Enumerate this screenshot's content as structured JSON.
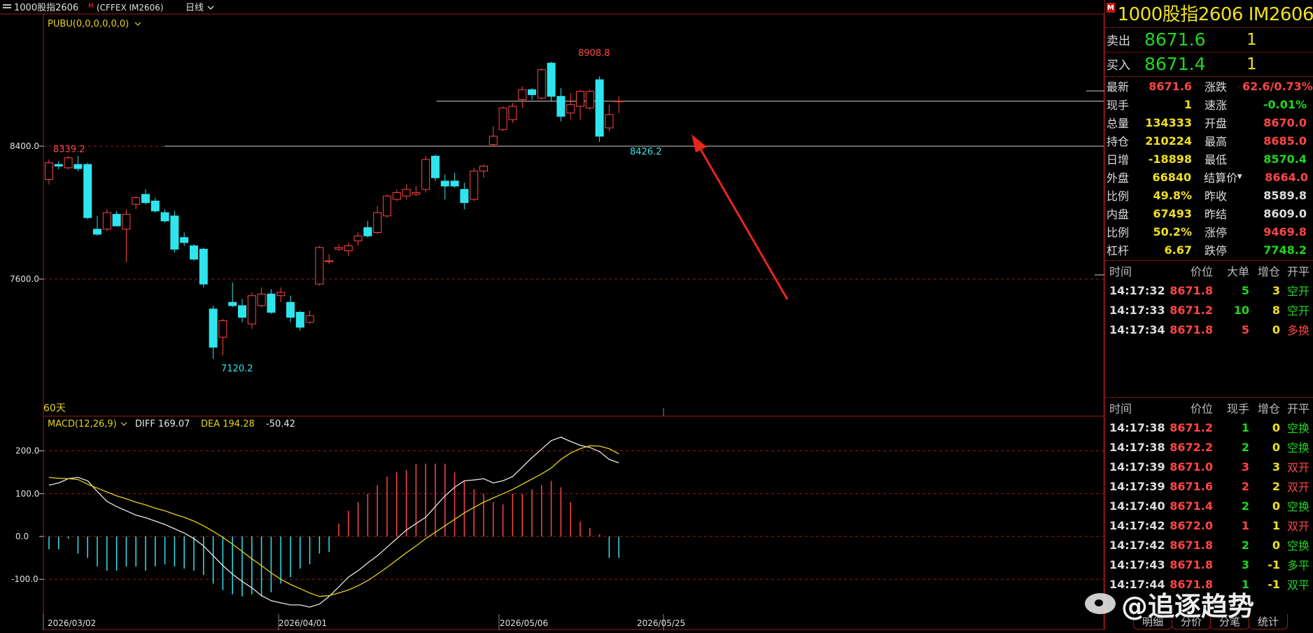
{
  "titlebar": {
    "symbol": "1000股指2606",
    "m_badge": "M",
    "exchange": "(CFFEX IM2606)",
    "period": "日线"
  },
  "main_indicator": "PUBU(0,0,0,0,0,0)",
  "period_note": "60天",
  "macd_label": "MACD(12,26,9)",
  "macd_values": {
    "diff": "DIFF 169.07",
    "dea": "DEA 194.28",
    "macd": "-50.42"
  },
  "annotations": {
    "high": "8908.8",
    "left": "8339.2",
    "low": "7120.2",
    "recent_low": "8426.2"
  },
  "dates": [
    "2026/03/02",
    "2026/04/01",
    "2026/05/06",
    "2026/05/25"
  ],
  "chart_data": [
    {
      "type": "candlestick",
      "ylabel": "",
      "yticks": [
        8400.0,
        7600.0
      ],
      "ytick_labels": [
        "8400.0",
        "7600.0"
      ],
      "ylim": [
        7070,
        9000
      ],
      "hlines": [
        8400.0,
        8671.0
      ],
      "candles": [
        {
          "o": 8200,
          "h": 8320,
          "l": 8170,
          "c": 8300
        },
        {
          "o": 8290,
          "h": 8310,
          "l": 8260,
          "c": 8280
        },
        {
          "o": 8270,
          "h": 8340,
          "l": 8260,
          "c": 8330
        },
        {
          "o": 8290,
          "h": 8340,
          "l": 8250,
          "c": 8265
        },
        {
          "o": 8290,
          "h": 8300,
          "l": 7960,
          "c": 7970
        },
        {
          "o": 7900,
          "h": 7980,
          "l": 7860,
          "c": 7870
        },
        {
          "o": 7900,
          "h": 8020,
          "l": 7890,
          "c": 8000
        },
        {
          "o": 7990,
          "h": 8010,
          "l": 7920,
          "c": 7920
        },
        {
          "o": 7900,
          "h": 8020,
          "l": 7700,
          "c": 7990
        },
        {
          "o": 8050,
          "h": 8100,
          "l": 8020,
          "c": 8090
        },
        {
          "o": 8110,
          "h": 8140,
          "l": 8050,
          "c": 8060
        },
        {
          "o": 8070,
          "h": 8090,
          "l": 8000,
          "c": 8010
        },
        {
          "o": 8000,
          "h": 8020,
          "l": 7940,
          "c": 7950
        },
        {
          "o": 7980,
          "h": 8010,
          "l": 7760,
          "c": 7780
        },
        {
          "o": 7850,
          "h": 7880,
          "l": 7800,
          "c": 7820
        },
        {
          "o": 7800,
          "h": 7810,
          "l": 7710,
          "c": 7720
        },
        {
          "o": 7780,
          "h": 7790,
          "l": 7550,
          "c": 7570
        },
        {
          "o": 7420,
          "h": 7440,
          "l": 7120,
          "c": 7190
        },
        {
          "o": 7250,
          "h": 7360,
          "l": 7140,
          "c": 7350
        },
        {
          "o": 7460,
          "h": 7580,
          "l": 7430,
          "c": 7440
        },
        {
          "o": 7440,
          "h": 7480,
          "l": 7340,
          "c": 7370
        },
        {
          "o": 7330,
          "h": 7520,
          "l": 7300,
          "c": 7500
        },
        {
          "o": 7440,
          "h": 7550,
          "l": 7430,
          "c": 7510
        },
        {
          "o": 7510,
          "h": 7540,
          "l": 7390,
          "c": 7400
        },
        {
          "o": 7500,
          "h": 7550,
          "l": 7460,
          "c": 7520
        },
        {
          "o": 7460,
          "h": 7500,
          "l": 7340,
          "c": 7370
        },
        {
          "o": 7400,
          "h": 7410,
          "l": 7290,
          "c": 7310
        },
        {
          "o": 7340,
          "h": 7410,
          "l": 7330,
          "c": 7380
        },
        {
          "o": 7570,
          "h": 7800,
          "l": 7560,
          "c": 7790
        },
        {
          "o": 7710,
          "h": 7750,
          "l": 7690,
          "c": 7710
        },
        {
          "o": 7780,
          "h": 7810,
          "l": 7770,
          "c": 7790
        },
        {
          "o": 7770,
          "h": 7820,
          "l": 7740,
          "c": 7800
        },
        {
          "o": 7830,
          "h": 7880,
          "l": 7800,
          "c": 7860
        },
        {
          "o": 7910,
          "h": 7950,
          "l": 7850,
          "c": 7860
        },
        {
          "o": 7880,
          "h": 8040,
          "l": 7870,
          "c": 8000
        },
        {
          "o": 7980,
          "h": 8110,
          "l": 7970,
          "c": 8100
        },
        {
          "o": 8080,
          "h": 8140,
          "l": 8070,
          "c": 8120
        },
        {
          "o": 8100,
          "h": 8170,
          "l": 8080,
          "c": 8140
        },
        {
          "o": 8110,
          "h": 8160,
          "l": 8100,
          "c": 8120
        },
        {
          "o": 8140,
          "h": 8340,
          "l": 8120,
          "c": 8320
        },
        {
          "o": 8340,
          "h": 8350,
          "l": 8190,
          "c": 8210
        },
        {
          "o": 8190,
          "h": 8230,
          "l": 8080,
          "c": 8160
        },
        {
          "o": 8190,
          "h": 8240,
          "l": 8150,
          "c": 8160
        },
        {
          "o": 8140,
          "h": 8180,
          "l": 8020,
          "c": 8060
        },
        {
          "o": 8080,
          "h": 8270,
          "l": 8070,
          "c": 8250
        },
        {
          "o": 8250,
          "h": 8290,
          "l": 8210,
          "c": 8280
        },
        {
          "o": 8410,
          "h": 8520,
          "l": 8400,
          "c": 8460
        },
        {
          "o": 8500,
          "h": 8640,
          "l": 8490,
          "c": 8630
        },
        {
          "o": 8560,
          "h": 8660,
          "l": 8540,
          "c": 8640
        },
        {
          "o": 8680,
          "h": 8760,
          "l": 8630,
          "c": 8740
        },
        {
          "o": 8740,
          "h": 8750,
          "l": 8680,
          "c": 8710
        },
        {
          "o": 8690,
          "h": 8870,
          "l": 8680,
          "c": 8860
        },
        {
          "o": 8900,
          "h": 8909,
          "l": 8670,
          "c": 8700
        },
        {
          "o": 8700,
          "h": 8750,
          "l": 8550,
          "c": 8580
        },
        {
          "o": 8600,
          "h": 8720,
          "l": 8560,
          "c": 8650
        },
        {
          "o": 8640,
          "h": 8740,
          "l": 8560,
          "c": 8730
        },
        {
          "o": 8630,
          "h": 8740,
          "l": 8620,
          "c": 8730
        },
        {
          "o": 8800,
          "h": 8820,
          "l": 8426,
          "c": 8460
        },
        {
          "o": 8510,
          "h": 8650,
          "l": 8490,
          "c": 8590
        },
        {
          "o": 8670,
          "h": 8700,
          "l": 8600,
          "c": 8672
        }
      ]
    },
    {
      "type": "line",
      "ylabel": "",
      "yticks": [
        200.0,
        100.0,
        0.0,
        -100.0
      ],
      "ytick_labels": [
        "200.0",
        "100.0",
        "0.0",
        "-100.0"
      ],
      "ylim": [
        -180,
        250
      ],
      "series": [
        {
          "name": "DIFF",
          "values": [
            120,
            125,
            135,
            138,
            130,
            105,
            82,
            70,
            60,
            50,
            44,
            36,
            28,
            18,
            8,
            -5,
            -22,
            -45,
            -68,
            -88,
            -105,
            -120,
            -138,
            -150,
            -155,
            -160,
            -160,
            -165,
            -158,
            -140,
            -118,
            -95,
            -80,
            -62,
            -45,
            -25,
            -5,
            15,
            30,
            45,
            70,
            95,
            115,
            130,
            132,
            135,
            125,
            130,
            140,
            162,
            184,
            204,
            224,
            232,
            222,
            213,
            208,
            198,
            180,
            172
          ]
        },
        {
          "name": "DEA",
          "values": [
            138,
            136,
            135,
            133,
            122,
            113,
            104,
            95,
            88,
            80,
            74,
            66,
            60,
            52,
            45,
            36,
            25,
            12,
            -2,
            -18,
            -35,
            -52,
            -68,
            -85,
            -100,
            -112,
            -122,
            -132,
            -140,
            -138,
            -132,
            -125,
            -115,
            -103,
            -88,
            -72,
            -55,
            -38,
            -22,
            -5,
            10,
            25,
            40,
            55,
            68,
            80,
            90,
            100,
            110,
            122,
            134,
            146,
            160,
            180,
            195,
            205,
            212,
            211,
            205,
            193
          ]
        },
        {
          "name": "MACD",
          "values": [
            -30,
            -30,
            -5,
            -40,
            -50,
            -70,
            -80,
            -80,
            -70,
            -70,
            -80,
            -70,
            -65,
            -70,
            -75,
            -80,
            -90,
            -110,
            -125,
            -135,
            -140,
            -135,
            -140,
            -130,
            -110,
            -95,
            -75,
            -65,
            -40,
            -36,
            30,
            60,
            80,
            100,
            120,
            140,
            150,
            155,
            170,
            170,
            170,
            170,
            150,
            130,
            110,
            100,
            80,
            75,
            100,
            100,
            110,
            120,
            130,
            115,
            80,
            35,
            20,
            5,
            -50,
            -50
          ]
        }
      ]
    }
  ],
  "quote_panel": {
    "title": "1000股指2606   IM2606",
    "ask": {
      "label": "卖出",
      "price": "8671.6",
      "vol": "1"
    },
    "bid": {
      "label": "买入",
      "price": "8671.4",
      "vol": "1"
    },
    "stats": [
      {
        "lk": "最新",
        "lv": "8671.6",
        "lc": "r",
        "rk": "涨跌",
        "rv": "62.6/0.73%",
        "rc": "r"
      },
      {
        "lk": "现手",
        "lv": "1",
        "lc": "y",
        "rk": "速涨",
        "rv": "-0.01%",
        "rc": "g"
      },
      {
        "lk": "总量",
        "lv": "134333",
        "lc": "y",
        "rk": "开盘",
        "rv": "8670.0",
        "rc": "r"
      },
      {
        "lk": "持仓",
        "lv": "210224",
        "lc": "y",
        "rk": "最高",
        "rv": "8685.0",
        "rc": "r"
      },
      {
        "lk": "日增",
        "lv": "-18898",
        "lc": "y",
        "rk": "最低",
        "rv": "8570.4",
        "rc": "g"
      },
      {
        "lk": "外盘",
        "lv": "66840",
        "lc": "y",
        "rk": "结算价",
        "rv": "8664.0",
        "rc": "r"
      },
      {
        "lk": "比例",
        "lv": "49.8%",
        "lc": "y",
        "rk": "昨收",
        "rv": "8589.8",
        "rc": "w"
      },
      {
        "lk": "内盘",
        "lv": "67493",
        "lc": "y",
        "rk": "昨结",
        "rv": "8609.0",
        "rc": "w"
      },
      {
        "lk": "比例",
        "lv": "50.2%",
        "lc": "y",
        "rk": "涨停",
        "rv": "9469.8",
        "rc": "r"
      },
      {
        "lk": "杠杆",
        "lv": "6.67",
        "lc": "y",
        "rk": "跌停",
        "rv": "7748.2",
        "rc": "g"
      }
    ],
    "big_trades": {
      "headers": [
        "时间",
        "价位",
        "大单",
        "增仓",
        "开平"
      ],
      "rows": [
        {
          "t": "14:17:32",
          "p": "8671.8",
          "v": "5",
          "oi": "3",
          "type": "空开",
          "vc": "g"
        },
        {
          "t": "14:17:33",
          "p": "8671.2",
          "v": "10",
          "oi": "8",
          "type": "空开",
          "vc": "g"
        },
        {
          "t": "14:17:34",
          "p": "8671.8",
          "v": "5",
          "oi": "0",
          "type": "多换",
          "vc": "r"
        }
      ]
    },
    "ticks": {
      "headers": [
        "时间",
        "价位",
        "现手",
        "增仓",
        "开平"
      ],
      "rows": [
        {
          "t": "14:17:38",
          "p": "8671.2",
          "v": "1",
          "oi": "0",
          "type": "空换",
          "vc": "g"
        },
        {
          "t": "14:17:38",
          "p": "8672.2",
          "v": "2",
          "oi": "0",
          "type": "空换",
          "vc": "g"
        },
        {
          "t": "14:17:39",
          "p": "8671.0",
          "v": "3",
          "oi": "3",
          "type": "双开",
          "vc": "r"
        },
        {
          "t": "14:17:39",
          "p": "8671.6",
          "v": "2",
          "oi": "2",
          "type": "双开",
          "vc": "r"
        },
        {
          "t": "14:17:40",
          "p": "8671.4",
          "v": "2",
          "oi": "0",
          "type": "空换",
          "vc": "g"
        },
        {
          "t": "14:17:42",
          "p": "8672.0",
          "v": "1",
          "oi": "1",
          "type": "双开",
          "vc": "r"
        },
        {
          "t": "14:17:42",
          "p": "8671.8",
          "v": "2",
          "oi": "0",
          "type": "空换",
          "vc": "g"
        },
        {
          "t": "14:17:43",
          "p": "8671.8",
          "v": "3",
          "oi": "-1",
          "type": "多平",
          "vc": "g"
        },
        {
          "t": "14:17:44",
          "p": "8671.8",
          "v": "1",
          "oi": "-1",
          "type": "双平",
          "vc": "g"
        }
      ]
    },
    "tabs": [
      "明细",
      "分价",
      "分笔",
      "统计"
    ]
  },
  "watermark": "@追逐趋势",
  "colors": {
    "up": "#ff4545",
    "down": "#2ee5ee",
    "diff": "#e8e8e8",
    "dea": "#e6d21c",
    "grid": "#9a1c1c",
    "arrow": "#e8251c"
  }
}
